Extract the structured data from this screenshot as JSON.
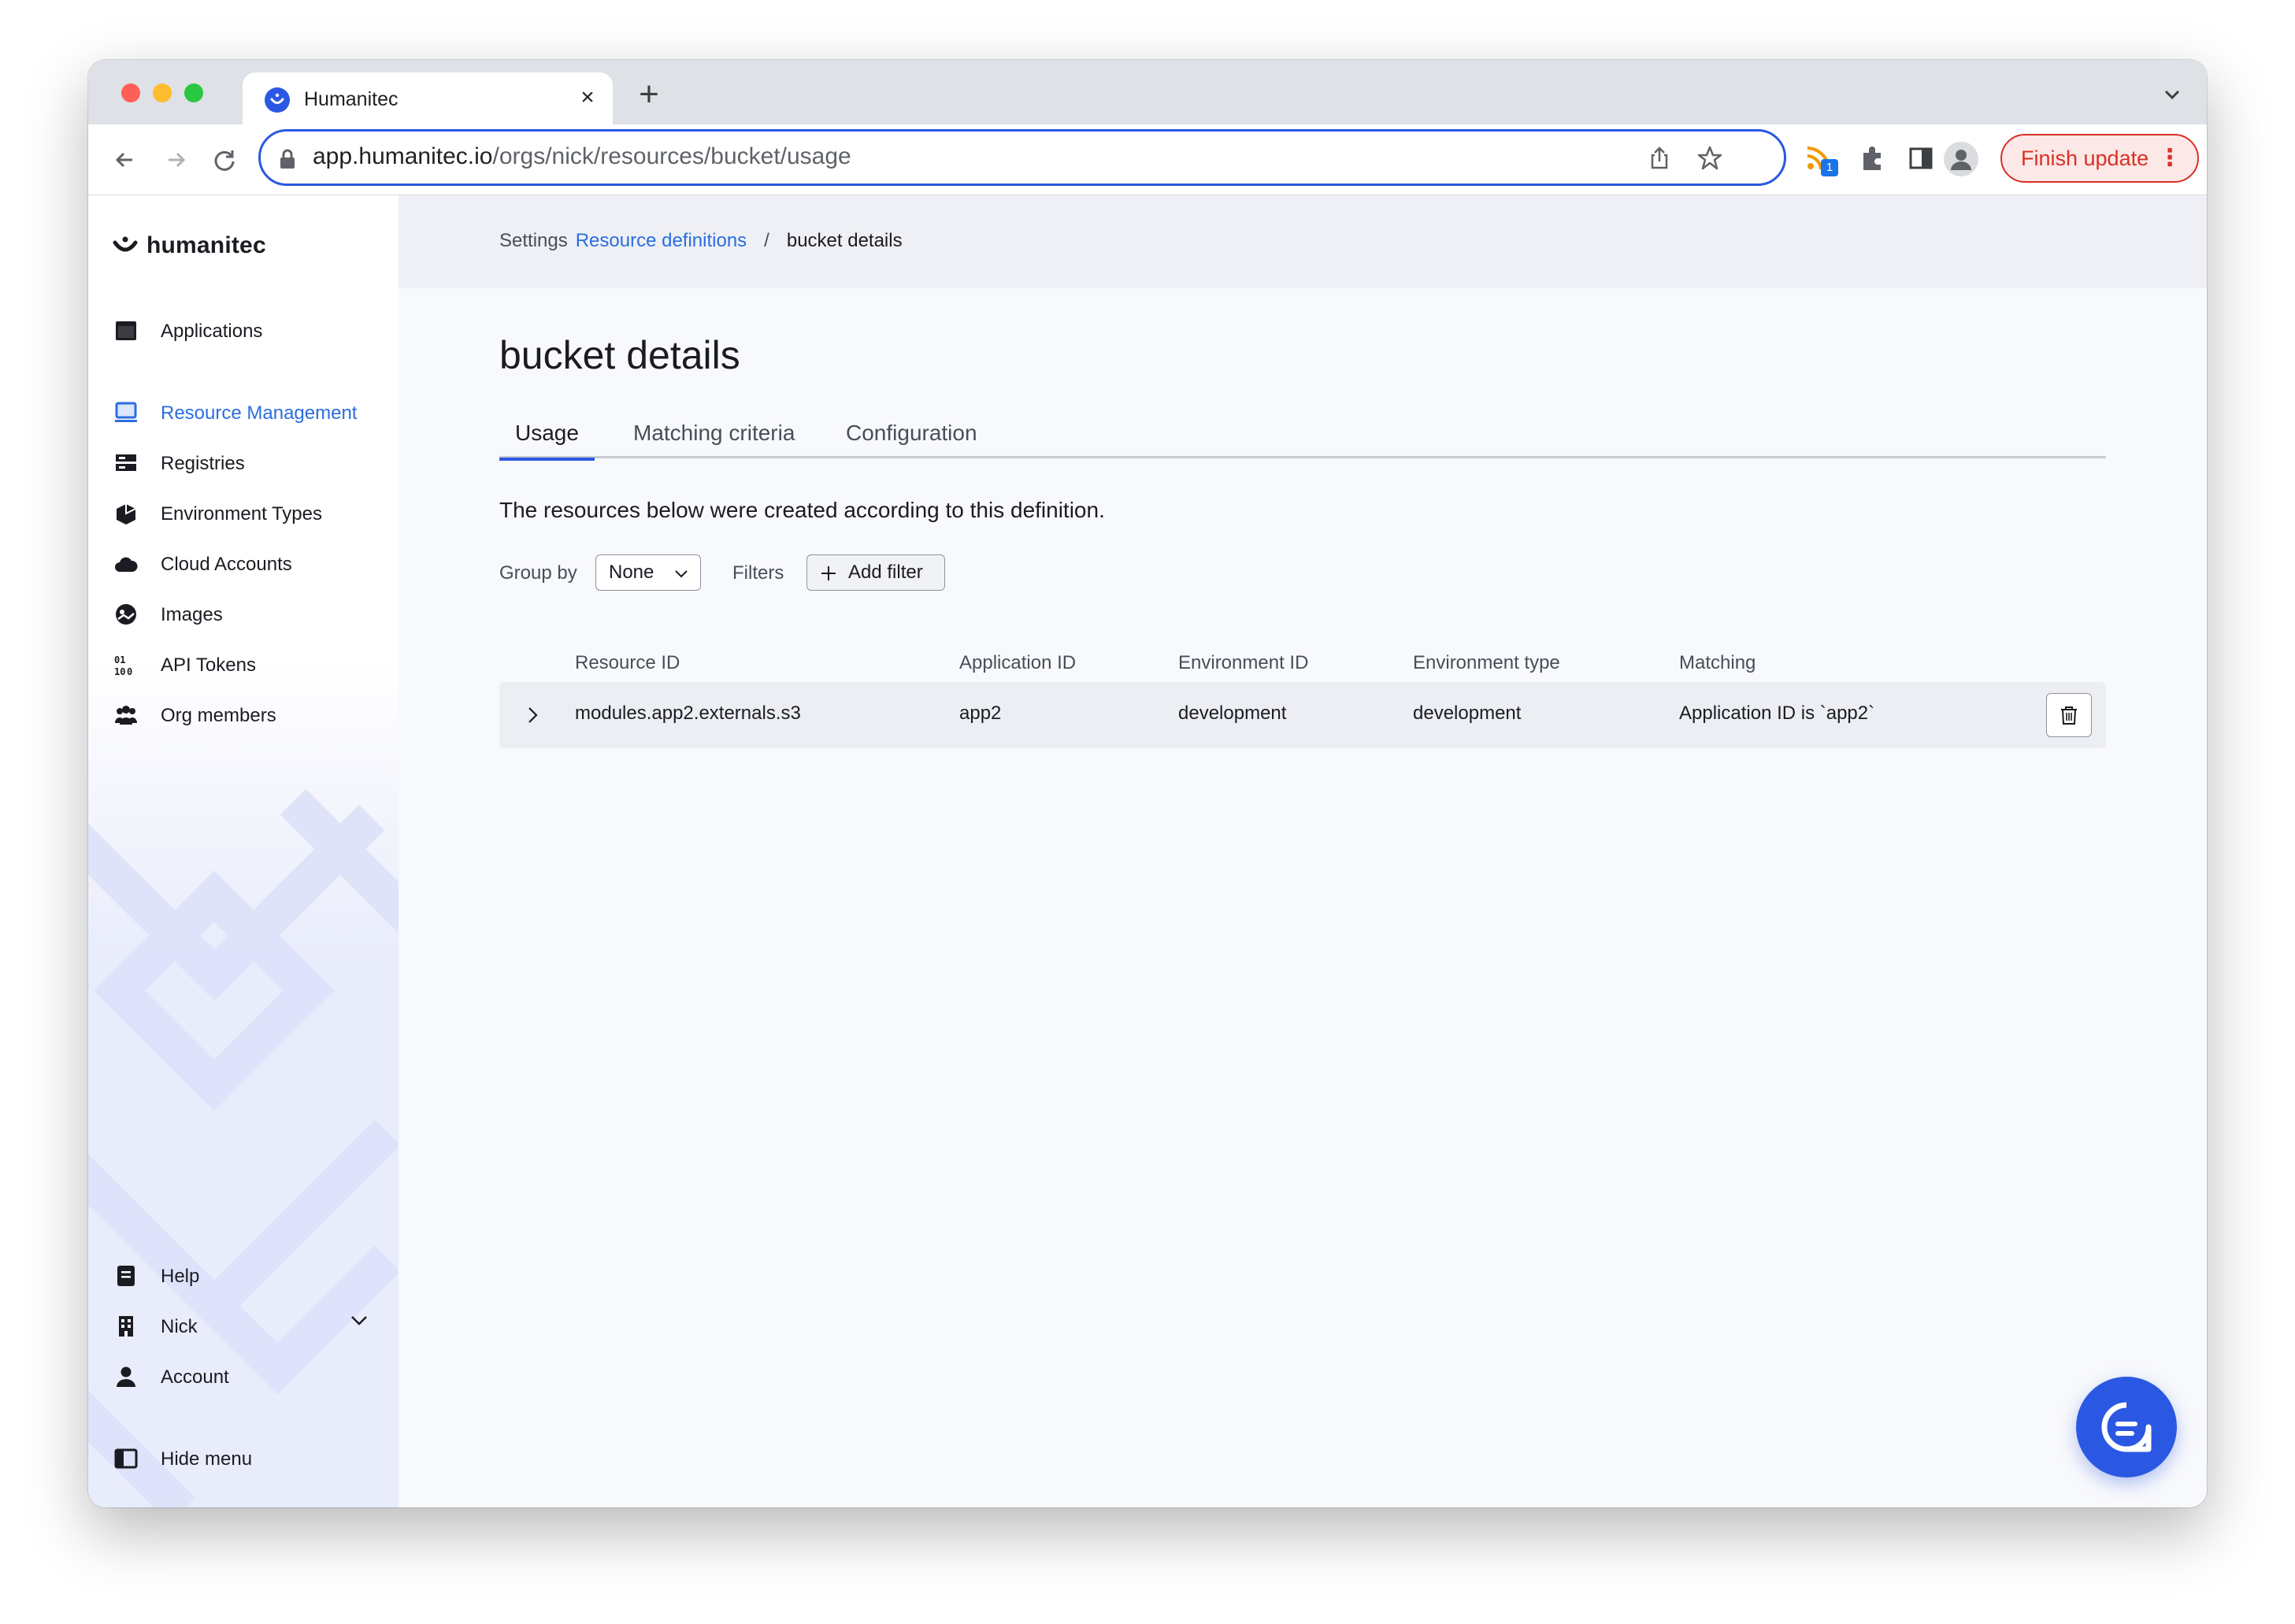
{
  "browser": {
    "tab_title": "Humanitec",
    "url_host": "app.humanitec.io",
    "url_path": "/orgs/nick/resources/bucket/usage",
    "extension_badge": "1",
    "finish_update_label": "Finish update"
  },
  "sidebar": {
    "brand": "humanitec",
    "items": [
      {
        "label": "Applications",
        "icon": "applications-icon"
      },
      {
        "label": "Resource Management",
        "icon": "resource-management-icon",
        "active": true
      },
      {
        "label": "Registries",
        "icon": "registries-icon"
      },
      {
        "label": "Environment Types",
        "icon": "environment-types-icon"
      },
      {
        "label": "Cloud Accounts",
        "icon": "cloud-accounts-icon"
      },
      {
        "label": "Images",
        "icon": "images-icon"
      },
      {
        "label": "API Tokens",
        "icon": "api-tokens-icon"
      },
      {
        "label": "Org members",
        "icon": "org-members-icon"
      }
    ],
    "bottom_items": [
      {
        "label": "Help",
        "icon": "help-icon"
      },
      {
        "label": "Nick",
        "icon": "organization-icon"
      },
      {
        "label": "Account",
        "icon": "account-icon"
      },
      {
        "label": "Hide menu",
        "icon": "hide-menu-icon"
      }
    ]
  },
  "breadcrumb": {
    "settings": "Settings",
    "resource_definitions": "Resource definitions",
    "separator": "/",
    "current": "bucket details"
  },
  "page": {
    "title": "bucket details",
    "tabs": [
      "Usage",
      "Matching criteria",
      "Configuration"
    ],
    "active_tab": "Usage",
    "description": "The resources below were created according to this definition."
  },
  "filters": {
    "group_by_label": "Group by",
    "group_by_value": "None",
    "filters_label": "Filters",
    "add_filter_label": "Add filter"
  },
  "table": {
    "headers": [
      "Resource ID",
      "Application ID",
      "Environment ID",
      "Environment type",
      "Matching"
    ],
    "rows": [
      [
        "modules.app2.externals.s3",
        "app2",
        "development",
        "development",
        "Application ID is `app2`"
      ]
    ]
  },
  "colors": {
    "accent": "#2b58e3",
    "link": "#2b6de0",
    "finish_update": "#d93025"
  }
}
